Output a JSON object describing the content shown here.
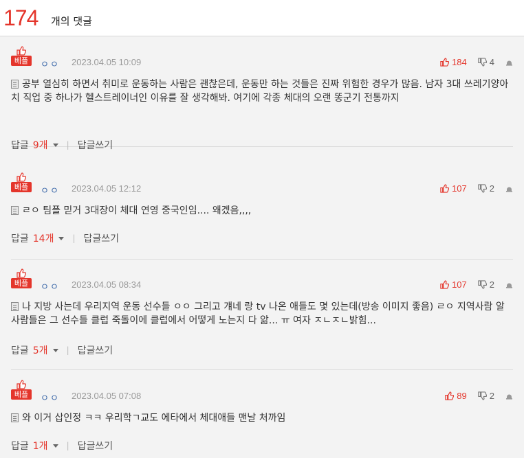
{
  "header": {
    "count": "174",
    "count_label": "개의 댓글"
  },
  "badge_label": "베플",
  "comments": [
    {
      "author": "ㅇㅇ",
      "date": "2023.04.05 10:09",
      "upvotes": "184",
      "downvotes": "4",
      "text": "공부 열심히 하면서 취미로 운동하는 사람은 괜찮은데, 운동만 하는 것들은 진짜 위험한 경우가 많음. 남자 3대 쓰레기양아치 직업 중 하나가 헬스트레이너인 이유를 잘 생각해봐. 여기에 각종 체대의 오랜 똥군기 전통까지",
      "reply_label": "답글",
      "reply_count": "9개",
      "write_label": "답글쓰기"
    },
    {
      "author": "ㅇㅇ",
      "date": "2023.04.05 12:12",
      "upvotes": "107",
      "downvotes": "2",
      "text": "ㄹㅇ 팀플 믿거 3대장이 체대 연영 중국인임.... 왜겠음,,,,",
      "reply_label": "답글",
      "reply_count": "14개",
      "write_label": "답글쓰기"
    },
    {
      "author": "ㅇㅇ",
      "date": "2023.04.05 08:34",
      "upvotes": "107",
      "downvotes": "2",
      "text": "나 지방 사는데 우리지역 운동 선수들 ㅇㅇ 그리고 걔네 랑 tv 나온 애들도 몇 있는데(방송 이미지 좋음) ㄹㅇ 지역사람 알 사람들은 그 선수들 클럽 죽돌이에 클럽에서 어떻게 노는지 다 앎... ㅠ 여자 ㅈㄴㅈㄴ밝힘...",
      "reply_label": "답글",
      "reply_count": "5개",
      "write_label": "답글쓰기"
    },
    {
      "author": "ㅇㅇ",
      "date": "2023.04.05 07:08",
      "upvotes": "89",
      "downvotes": "2",
      "text": "와 이거 삽인정 ㅋㅋ 우리학ㄱ교도 에타에서 체대애들 맨날 처까임",
      "reply_label": "답글",
      "reply_count": "1개",
      "write_label": "답글쓰기"
    }
  ],
  "icons": {
    "best": "thumbs-up-icon",
    "upvote": "thumbs-up-icon",
    "downvote": "thumbs-down-icon",
    "report": "report-icon",
    "text": "document-icon"
  },
  "colors": {
    "accent": "#e4352b",
    "author": "#3a67a8",
    "meta": "#999999"
  }
}
